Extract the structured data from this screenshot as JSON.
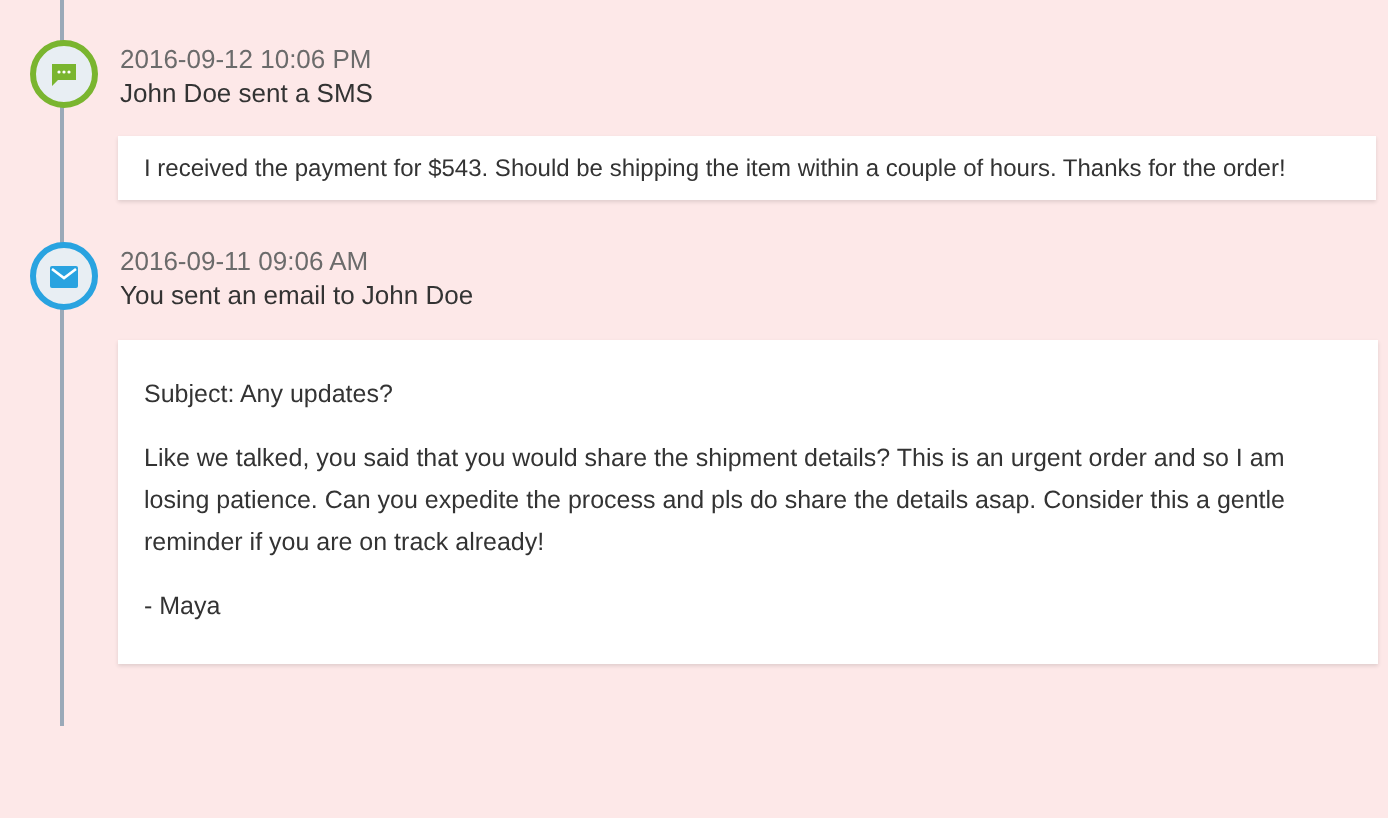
{
  "events": [
    {
      "kind": "sms",
      "timestamp": "2016-09-12 10:06 PM",
      "title": "John Doe sent a SMS",
      "lines": [
        "I received the payment for $543. Should be shipping the item within a couple of hours. Thanks for the order!"
      ]
    },
    {
      "kind": "email",
      "timestamp": "2016-09-11 09:06 AM",
      "title": "You sent an email to John Doe",
      "lines": [
        "Subject: Any updates?",
        "Like we talked, you said that you would share the shipment details? This is an urgent order and so I am losing patience. Can you expedite the process and pls do share the details asap. Consider this a gentle reminder if you are on track already!",
        "- Maya"
      ]
    }
  ]
}
